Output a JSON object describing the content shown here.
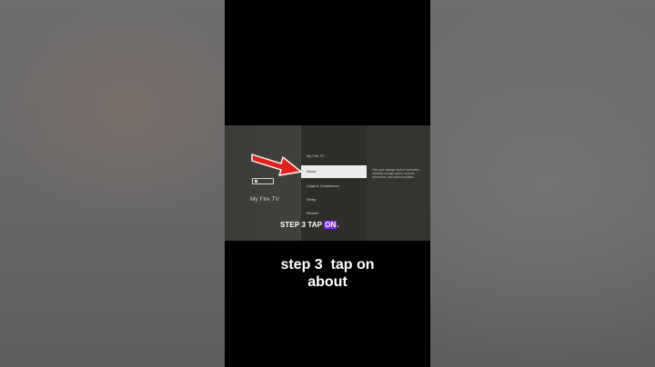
{
  "tv_screen": {
    "device_label": "My Fire TV",
    "menu_items": [
      "My Fire TV",
      "About",
      "Legal & Compliance",
      "Sleep",
      "Restart"
    ],
    "selected_item": "About",
    "description": "View and manage device information, available storage space, network connection, and system updates.",
    "overlay_caption_prefix": "STEP 3 TAP ",
    "overlay_caption_highlight": "ON",
    "overlay_caption_suffix": ".",
    "highlight_color": "#7a2cff",
    "arrow_color": "#e0231e"
  },
  "caption": {
    "line1": "step 3  tap on",
    "line2": "about"
  }
}
